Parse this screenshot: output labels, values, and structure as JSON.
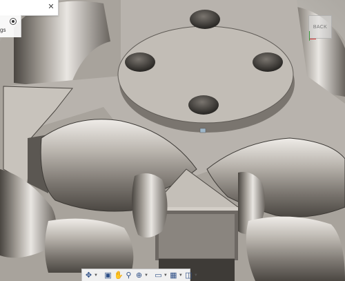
{
  "browser": {
    "row_label": "gs",
    "close_icon": "close-icon",
    "radio_icon": "radio-button-icon"
  },
  "viewcube": {
    "face_label": "BACK",
    "axis_colors": {
      "x": "#d32f2f",
      "y": "#3a9b3a"
    }
  },
  "viewport": {
    "model": "omni-wheel hub with rollers",
    "model_color": "#b8b3ad",
    "background": "#c9c6c1"
  },
  "toolbar": {
    "buttons": [
      {
        "name": "orbit-button",
        "icon": "orbit-icon",
        "glyph": "✥",
        "dropdown": true
      },
      {
        "name": "look-at-button",
        "icon": "look-at-icon",
        "glyph": "▣",
        "dropdown": false
      },
      {
        "name": "pan-button",
        "icon": "hand-icon",
        "glyph": "✋",
        "dropdown": false
      },
      {
        "name": "zoom-button",
        "icon": "zoom-icon",
        "glyph": "⚲",
        "dropdown": false
      },
      {
        "name": "fit-button",
        "icon": "fit-icon",
        "glyph": "⊕",
        "dropdown": true
      },
      {
        "name": "display-settings-button",
        "icon": "display-settings-icon",
        "glyph": "▭",
        "dropdown": true
      },
      {
        "name": "grid-settings-button",
        "icon": "grid-icon",
        "glyph": "▦",
        "dropdown": true
      },
      {
        "name": "viewports-button",
        "icon": "viewports-icon",
        "glyph": "◫",
        "dropdown": true
      }
    ]
  }
}
